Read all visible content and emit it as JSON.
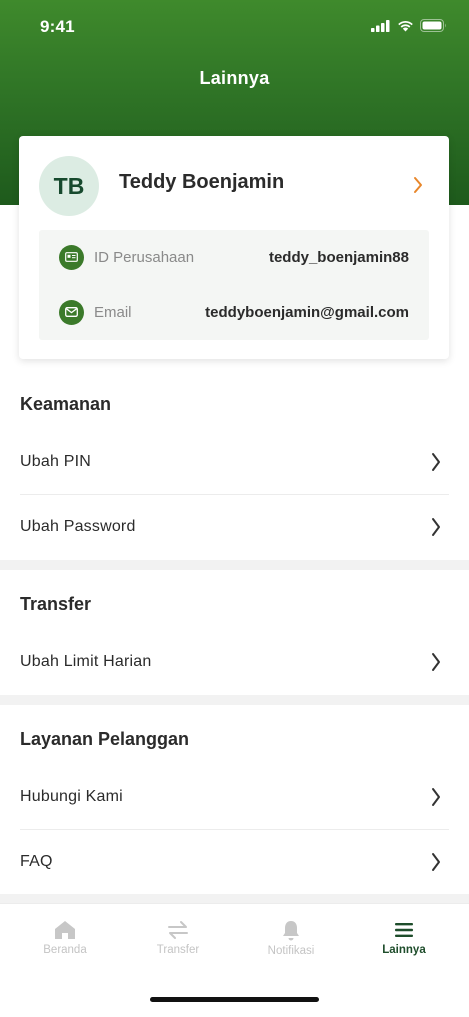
{
  "status_bar": {
    "time": "9:41"
  },
  "header": {
    "title": "Lainnya"
  },
  "profile": {
    "initials": "TB",
    "name": "Teddy Boenjamin",
    "company_id_label": "ID Perusahaan",
    "company_id_value": "teddy_boenjamin88",
    "email_label": "Email",
    "email_value": "teddyboenjamin@gmail.com"
  },
  "sections": {
    "security": {
      "title": "Keamanan",
      "items": [
        "Ubah PIN",
        "Ubah Password"
      ]
    },
    "transfer": {
      "title": "Transfer",
      "items": [
        "Ubah Limit Harian"
      ]
    },
    "customer_service": {
      "title": "Layanan Pelanggan",
      "items": [
        "Hubungi Kami",
        "FAQ"
      ]
    }
  },
  "tabbar": {
    "tabs": [
      {
        "label": "Beranda",
        "icon": "home-icon"
      },
      {
        "label": "Transfer",
        "icon": "transfer-arrows-icon"
      },
      {
        "label": "Notifikasi",
        "icon": "bell-icon"
      },
      {
        "label": "Lainnya",
        "icon": "menu-lines-icon",
        "active": true
      }
    ]
  },
  "colors": {
    "header_green": "#2f7426",
    "accent_orange": "#e8862a",
    "active_tab": "#1e4d2b",
    "icon_green": "#3b7a2a"
  }
}
